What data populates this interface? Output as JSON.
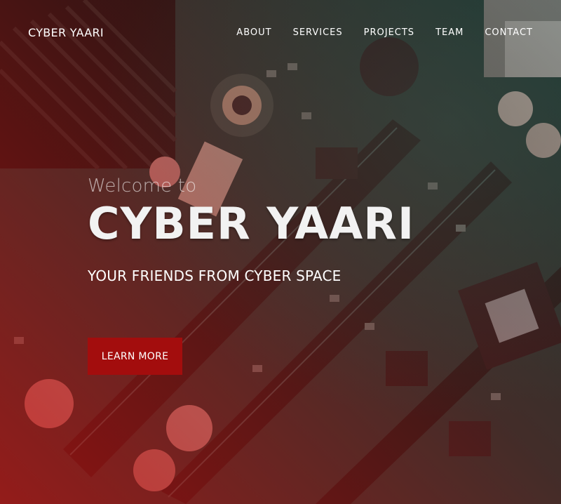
{
  "nav": {
    "brand": "CYBER YAARI",
    "links": [
      "ABOUT",
      "SERVICES",
      "PROJECTS",
      "TEAM",
      "CONTACT"
    ]
  },
  "hero": {
    "welcome": "Welcome to",
    "headline": "CYBER YAARI",
    "tagline": "YOUR FRIENDS FROM CYBER SPACE",
    "cta_label": "LEARN MORE",
    "background_image": "circuit-board-photo",
    "overlay_color": "#c0101a",
    "accent_color": "#a30d0d"
  }
}
